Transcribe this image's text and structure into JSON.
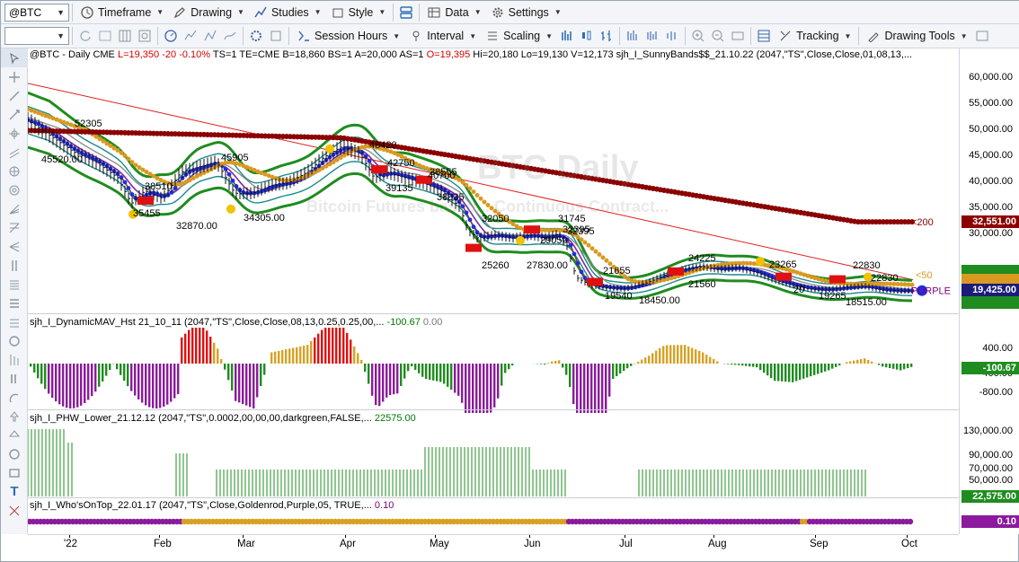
{
  "toolbar": {
    "symbol": "@BTC",
    "timeframe": "Timeframe",
    "drawing": "Drawing",
    "studies": "Studies",
    "style": "Style",
    "data": "Data",
    "settings": "Settings",
    "session_hours": "Session Hours",
    "interval": "Interval",
    "scaling": "Scaling",
    "tracking": "Tracking",
    "drawing_tools": "Drawing Tools"
  },
  "main_panel": {
    "header_symbol": "@BTC - Daily  CME",
    "L": "L=19,350",
    "chg": "-20",
    "pct": "-0.10%",
    "info": "TS=1  TE=CME  B=18,860  BS=1  A=20,000  AS=1",
    "O": "O=19,395",
    "tail": "Hi=20,180  Lo=19,130  V=12,173  sjh_I_SunnyBands$$_21.10.22 (2047,\"TS\",Close,Close,01,08,13,...",
    "watermark": "BTC Daily",
    "watermark2": "Bitcoin Futures based...  Continuous Contract...",
    "ma200_label": "<200",
    "ma50_label": "<50",
    "purple_label": "PURPLE",
    "price_labels": [
      "52305",
      "45520.00",
      "38510",
      "35455",
      "32870.00",
      "34305.00",
      "45905",
      "48420",
      "42750",
      "39135",
      "40700",
      "38555",
      "38035",
      "32050",
      "25260",
      "27830.00",
      "32395",
      "29050",
      "31745",
      "32395",
      "21655",
      "19540",
      "18450.00",
      "24225",
      "21560",
      "23265",
      "22830",
      "20",
      "19265",
      "18515.00",
      "22830"
    ]
  },
  "main_axis": {
    "ticks": [
      "60,000.00",
      "55,000.00",
      "50,000.00",
      "45,000.00",
      "40,000.00",
      "35,000.00",
      "30,000.00"
    ],
    "ma200_value": "32,551.00",
    "last_price": "19,425.00",
    "colors": {
      "ma200": "#8b0000",
      "last": "#1c1c7a",
      "greenband": "#1f8c1f",
      "tealband": "#1a8a8a"
    }
  },
  "panel2": {
    "title": "sjh_I_DynamicMAV_Hst 21_10_11 (2047,\"TS\",Close,Close,08,13,0.25,0.25,00,...",
    "val1": "-100.67",
    "val2": "0.00",
    "ticks": [
      "400.00",
      "-400.00",
      "-800.00"
    ],
    "last": "-100.67"
  },
  "panel3": {
    "title": "sjh_I_PHW_Lower_21.12.12 (2047,\"TS\",0.0002,00,00,00,darkgreen,FALSE,...",
    "val": "22575.00",
    "ticks": [
      "130,000.00",
      "90,000.00",
      "70,000.00",
      "50,000.00"
    ],
    "last": "22,575.00"
  },
  "panel4": {
    "title": "sjh_I_Who'sOnTop_22.01.17 (2047,\"TS\",Close,Goldenrod,Purple,05, TRUE,...",
    "val": "0.10",
    "last": "0.10"
  },
  "xaxis": {
    "months": [
      "'22",
      "Feb",
      "Mar",
      "Apr",
      "May",
      "Jun",
      "Jul",
      "Aug",
      "Sep",
      "Oct"
    ]
  }
}
